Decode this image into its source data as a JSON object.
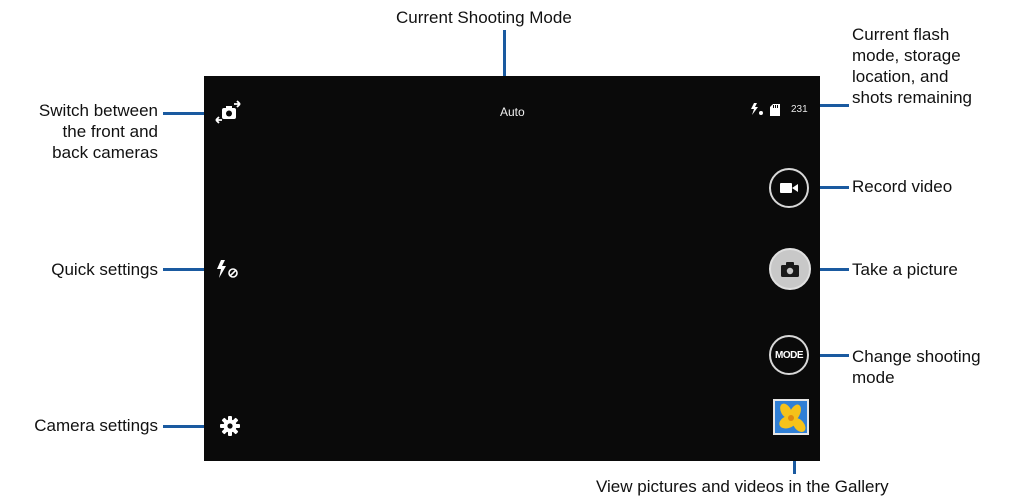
{
  "callouts": {
    "current_shooting_mode": "Current Shooting Mode",
    "flash_storage": "Current flash\nmode, storage\nlocation, and\nshots remaining",
    "switch_cameras": "Switch between\nthe front and\nback cameras",
    "record_video": "Record video",
    "quick_settings": "Quick settings",
    "take_picture": "Take a picture",
    "change_mode": "Change shooting\nmode",
    "camera_settings": "Camera settings",
    "gallery": "View pictures and videos in the Gallery"
  },
  "screen": {
    "mode": "Auto",
    "shots_remaining": "231",
    "mode_button_label": "MODE"
  },
  "icons": {
    "switch_camera": "switch-camera-icon",
    "flash_off": "flash-off-icon",
    "settings": "gear-icon",
    "flash_mode": "flash-auto-icon",
    "storage": "sd-card-icon",
    "video": "video-camera-icon",
    "camera": "camera-icon",
    "gallery": "gallery-thumbnail-icon"
  },
  "colors": {
    "leader": "#1a5aa0",
    "screen_bg": "#0a0a0a"
  }
}
